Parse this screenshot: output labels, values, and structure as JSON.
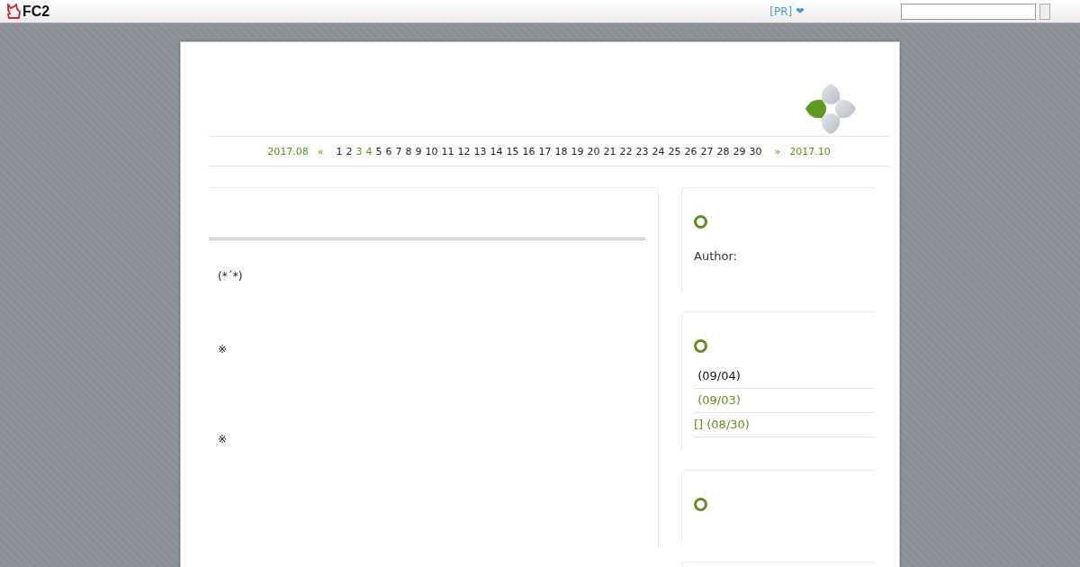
{
  "topbar": {
    "logo": "FC2",
    "pr_link": "[PR]",
    "heart": "❤"
  },
  "calendar": {
    "prev_month": "2017.08",
    "prev_arrow": "«",
    "next_arrow": "»",
    "next_month": "2017.10",
    "days": [
      {
        "label": "1",
        "linked": false
      },
      {
        "label": "2",
        "linked": false
      },
      {
        "label": "3",
        "linked": true
      },
      {
        "label": "4",
        "linked": true
      },
      {
        "label": "5",
        "linked": false
      },
      {
        "label": "6",
        "linked": false
      },
      {
        "label": "7",
        "linked": false
      },
      {
        "label": "8",
        "linked": false
      },
      {
        "label": "9",
        "linked": false
      },
      {
        "label": "10",
        "linked": false
      },
      {
        "label": "11",
        "linked": false
      },
      {
        "label": "12",
        "linked": false
      },
      {
        "label": "13",
        "linked": false
      },
      {
        "label": "14",
        "linked": false
      },
      {
        "label": "15",
        "linked": false
      },
      {
        "label": "16",
        "linked": false
      },
      {
        "label": "17",
        "linked": false
      },
      {
        "label": "18",
        "linked": false
      },
      {
        "label": "19",
        "linked": false
      },
      {
        "label": "20",
        "linked": false
      },
      {
        "label": "21",
        "linked": false
      },
      {
        "label": "22",
        "linked": false
      },
      {
        "label": "23",
        "linked": false
      },
      {
        "label": "24",
        "linked": false
      },
      {
        "label": "25",
        "linked": false
      },
      {
        "label": "26",
        "linked": false
      },
      {
        "label": "27",
        "linked": false
      },
      {
        "label": "28",
        "linked": false
      },
      {
        "label": "29",
        "linked": false
      },
      {
        "label": "30",
        "linked": false
      }
    ]
  },
  "entry": {
    "paragraphs": [
      "(*´*)",
      "※",
      "※"
    ]
  },
  "sidebar": [
    {
      "kind": "profile",
      "text": "Author:"
    },
    {
      "kind": "list",
      "items": [
        {
          "text": " (09/04)",
          "current": true
        },
        {
          "text": " (09/03)",
          "current": false
        },
        {
          "text": "[] (08/30)",
          "current": false
        }
      ]
    },
    {
      "kind": "empty"
    }
  ]
}
